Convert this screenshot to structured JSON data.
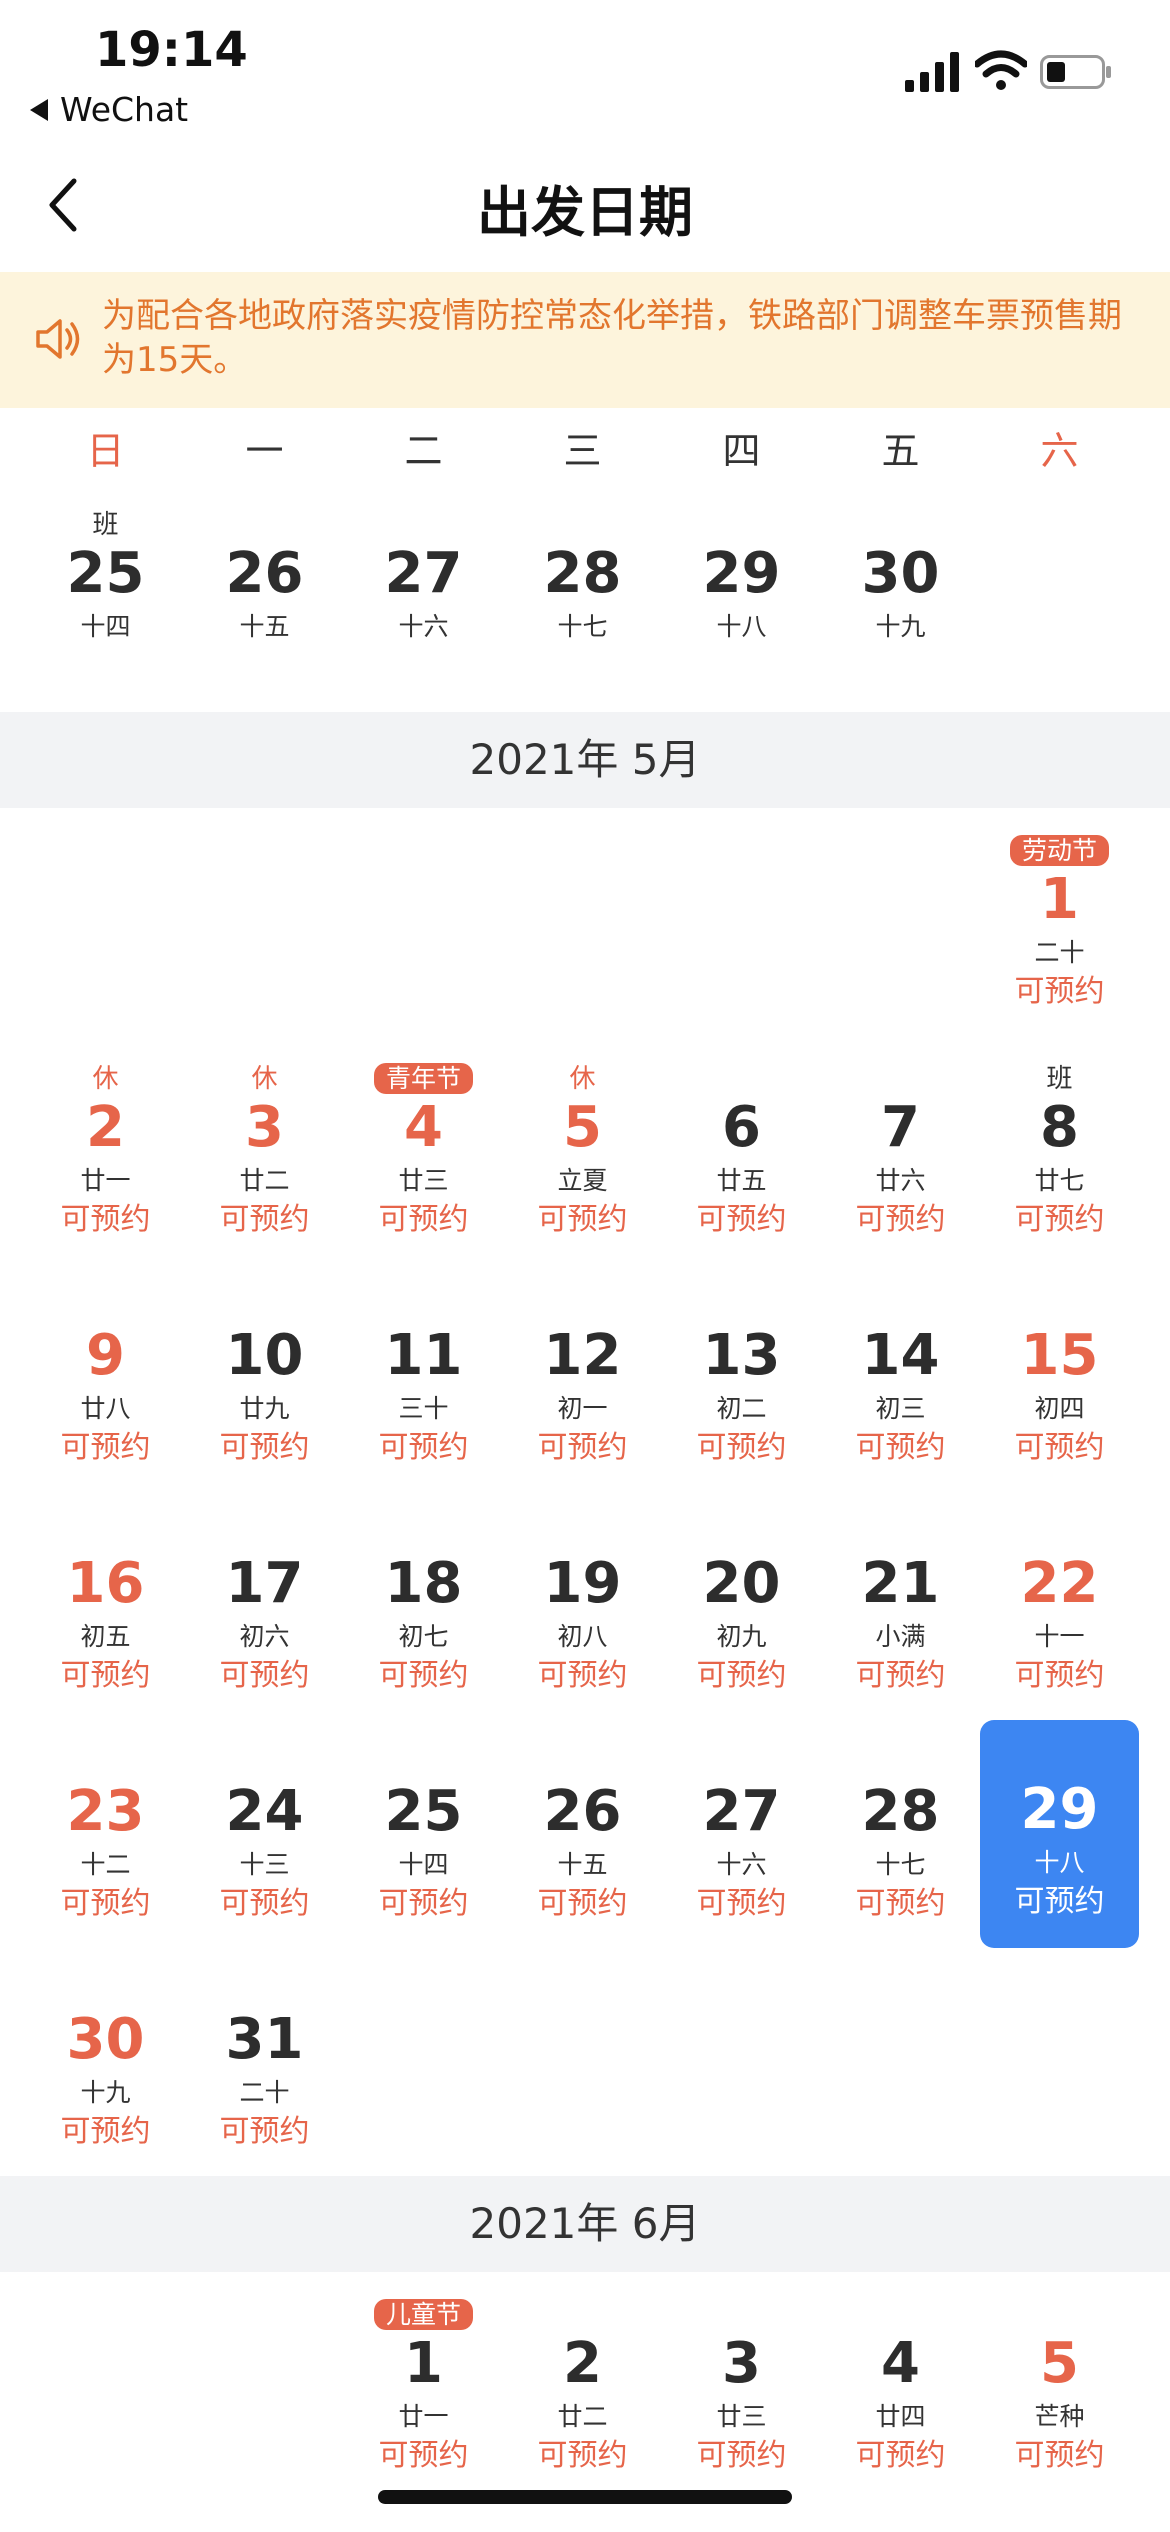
{
  "status": {
    "time": "19:14",
    "back_app": "WeChat"
  },
  "nav": {
    "title": "出发日期"
  },
  "notice": {
    "text": "为配合各地政府落实疫情防控常态化举措，铁路部门调整车票预售期为15天。"
  },
  "weekdays": [
    "日",
    "一",
    "二",
    "三",
    "四",
    "五",
    "六"
  ],
  "april_tail": [
    {
      "tag": "班",
      "num": "25",
      "lunar": "十四"
    },
    {
      "num": "26",
      "lunar": "十五"
    },
    {
      "num": "27",
      "lunar": "十六"
    },
    {
      "num": "28",
      "lunar": "十七"
    },
    {
      "num": "29",
      "lunar": "十八"
    },
    {
      "num": "30",
      "lunar": "十九"
    }
  ],
  "may": {
    "header": "2021年 5月",
    "days": [
      {
        "num": "1",
        "lunar": "二十",
        "tag": "劳动节",
        "avail": "可预约"
      },
      {
        "num": "2",
        "lunar": "廿一",
        "tag": "休",
        "avail": "可预约"
      },
      {
        "num": "3",
        "lunar": "廿二",
        "tag": "休",
        "avail": "可预约"
      },
      {
        "num": "4",
        "lunar": "廿三",
        "tag": "青年节",
        "avail": "可预约"
      },
      {
        "num": "5",
        "lunar": "立夏",
        "tag": "休",
        "avail": "可预约"
      },
      {
        "num": "6",
        "lunar": "廿五",
        "avail": "可预约"
      },
      {
        "num": "7",
        "lunar": "廿六",
        "avail": "可预约"
      },
      {
        "num": "8",
        "lunar": "廿七",
        "tag": "班",
        "avail": "可预约"
      },
      {
        "num": "9",
        "lunar": "廿八",
        "avail": "可预约"
      },
      {
        "num": "10",
        "lunar": "廿九",
        "avail": "可预约"
      },
      {
        "num": "11",
        "lunar": "三十",
        "avail": "可预约"
      },
      {
        "num": "12",
        "lunar": "初一",
        "avail": "可预约"
      },
      {
        "num": "13",
        "lunar": "初二",
        "avail": "可预约"
      },
      {
        "num": "14",
        "lunar": "初三",
        "avail": "可预约"
      },
      {
        "num": "15",
        "lunar": "初四",
        "avail": "可预约"
      },
      {
        "num": "16",
        "lunar": "初五",
        "avail": "可预约"
      },
      {
        "num": "17",
        "lunar": "初六",
        "avail": "可预约"
      },
      {
        "num": "18",
        "lunar": "初七",
        "avail": "可预约"
      },
      {
        "num": "19",
        "lunar": "初八",
        "avail": "可预约"
      },
      {
        "num": "20",
        "lunar": "初九",
        "avail": "可预约"
      },
      {
        "num": "21",
        "lunar": "小满",
        "avail": "可预约"
      },
      {
        "num": "22",
        "lunar": "十一",
        "avail": "可预约"
      },
      {
        "num": "23",
        "lunar": "十二",
        "avail": "可预约"
      },
      {
        "num": "24",
        "lunar": "十三",
        "avail": "可预约"
      },
      {
        "num": "25",
        "lunar": "十四",
        "avail": "可预约"
      },
      {
        "num": "26",
        "lunar": "十五",
        "avail": "可预约"
      },
      {
        "num": "27",
        "lunar": "十六",
        "avail": "可预约"
      },
      {
        "num": "28",
        "lunar": "十七",
        "avail": "可预约"
      },
      {
        "num": "29",
        "lunar": "十八",
        "avail": "可预约",
        "selected": true
      },
      {
        "num": "30",
        "lunar": "十九",
        "avail": "可预约"
      },
      {
        "num": "31",
        "lunar": "二十",
        "avail": "可预约"
      }
    ]
  },
  "june": {
    "header": "2021年 6月",
    "days": [
      {
        "num": "1",
        "lunar": "廿一",
        "tag": "儿童节",
        "avail": "可预约"
      },
      {
        "num": "2",
        "lunar": "廿二",
        "avail": "可预约"
      },
      {
        "num": "3",
        "lunar": "廿三",
        "avail": "可预约"
      },
      {
        "num": "4",
        "lunar": "廿四",
        "avail": "可预约"
      },
      {
        "num": "5",
        "lunar": "芒种",
        "avail": "可预约"
      }
    ]
  },
  "colors": {
    "accent_red": "#e6654a",
    "selected_blue": "#3d86f2",
    "notice_bg": "#fdf4dc",
    "notice_text": "#e2762e"
  }
}
